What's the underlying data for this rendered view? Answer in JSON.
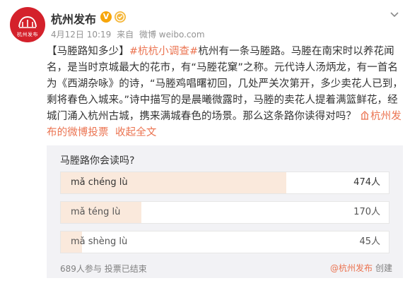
{
  "account": {
    "name": "杭州发布",
    "avatar_text": "杭州发布",
    "timestamp": "4月12日 10:19",
    "source_prefix": "来自",
    "source": "微博 weibo.com"
  },
  "post": {
    "segments": [
      {
        "text": "【马塍路知多少】",
        "link": false
      },
      {
        "text": "#杭杭小调查#",
        "link": true
      },
      {
        "text": "杭州有一条马塍路。马塍在南宋时以养花闻名，是当时京城最大的花市，有“马塍花窠”之称。元代诗人汤炳龙，有一首名为《西湖杂咏》的诗，“马塍鸡唱曙初回，几处严关次第开，多少卖花人已到，剩将春色入城来。”诗中描写的是晨曦微露时，马塍的卖花人提着满篮鲜花，经城门涌入杭州古城，携来满城春色的场景。那么这条路你读得对吗？",
        "link": false
      }
    ],
    "location_link": "杭州发布的微博投票",
    "collapse_link": "收起全文"
  },
  "poll": {
    "question": "马塍路你会读吗?",
    "options": [
      {
        "label": "mǎ chéng lù",
        "count": "474人",
        "share": 0.687,
        "selected": true
      },
      {
        "label": "mǎ téng lù",
        "count": "170人",
        "share": 0.246,
        "selected": false
      },
      {
        "label": "mǎ shèng lù",
        "count": "45人",
        "share": 0.065,
        "selected": false
      }
    ],
    "participants": "689人参与",
    "deadline": "投票已结束",
    "creator": "@杭州发布",
    "creator_suffix": "创建"
  },
  "colors": {
    "link": "#eb7350",
    "avatar": "#d4212b",
    "poll_fill": "#fae9dc",
    "poll_bg": "#f2f2f5"
  },
  "icons": [
    "chevron-down-icon",
    "verified-v-icon",
    "gold-badge-icon",
    "location-pin-icon"
  ]
}
